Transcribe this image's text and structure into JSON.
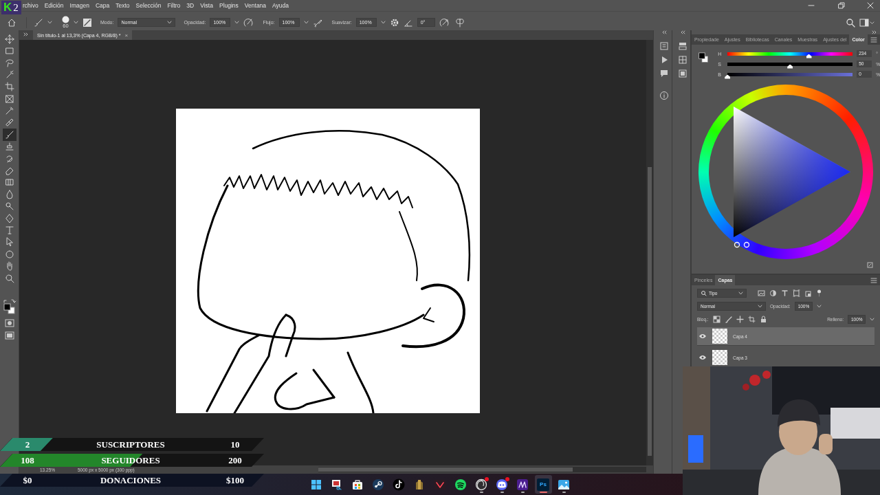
{
  "logo": {
    "mark": "K",
    "number": "2"
  },
  "menu": [
    "rchivo",
    "Edición",
    "Imagen",
    "Capa",
    "Texto",
    "Selección",
    "Filtro",
    "3D",
    "Vista",
    "Plugins",
    "Ventana",
    "Ayuda"
  ],
  "options": {
    "brush_size": "60",
    "mode_label": "Modo:",
    "mode": "Normal",
    "opacity_label": "Opacidad:",
    "opacity": "100%",
    "flow_label": "Flujo:",
    "flow": "100%",
    "smoothing_label": "Suavizar:",
    "smoothing": "100%",
    "angle": "0°"
  },
  "document_tab": {
    "title": "Sin título-1 al 13,3% (Capa 4, RGB/8) *",
    "close": "×"
  },
  "tools": [
    {
      "kind": "move",
      "selected": false
    },
    {
      "kind": "marquee",
      "selected": false
    },
    {
      "kind": "lasso",
      "selected": false
    },
    {
      "kind": "quick",
      "selected": false
    },
    {
      "kind": "crop",
      "selected": false
    },
    {
      "kind": "frame",
      "selected": false
    },
    {
      "kind": "eyedropper",
      "selected": false
    },
    {
      "kind": "healing",
      "selected": false
    },
    {
      "kind": "brush",
      "selected": true
    },
    {
      "kind": "stamp",
      "selected": false
    },
    {
      "kind": "history",
      "selected": false
    },
    {
      "kind": "eraser",
      "selected": false
    },
    {
      "kind": "gradient",
      "selected": false
    },
    {
      "kind": "blur",
      "selected": false
    },
    {
      "kind": "dodge",
      "selected": false
    },
    {
      "kind": "pen",
      "selected": false
    },
    {
      "kind": "text",
      "selected": false
    },
    {
      "kind": "pointer",
      "selected": false
    },
    {
      "kind": "shape",
      "selected": false
    },
    {
      "kind": "hand",
      "selected": false
    },
    {
      "kind": "zoom",
      "selected": false
    }
  ],
  "status_bar": {
    "zoom": "13.25%",
    "size": "5000 px x 5000 px (300 ppp)"
  },
  "color_panel": {
    "tabs": [
      {
        "label": "Propiedade",
        "selected": false
      },
      {
        "label": "Ajustes",
        "selected": false
      },
      {
        "label": "Bibliotecas",
        "selected": false
      },
      {
        "label": "Canales",
        "selected": false
      },
      {
        "label": "Muestras",
        "selected": false
      },
      {
        "label": "Ajustes del",
        "selected": false
      },
      {
        "label": "Color",
        "selected": true
      }
    ],
    "sliders": [
      {
        "kind": "hue",
        "label": "H",
        "value": "234",
        "unit": "°",
        "level": 0.65
      },
      {
        "kind": "saturation",
        "label": "S",
        "value": "50",
        "unit": "%",
        "level": 0.5
      },
      {
        "kind": "brightness",
        "label": "B",
        "value": "0",
        "unit": "%",
        "level": 0
      }
    ]
  },
  "layers_panel": {
    "tabs": [
      {
        "label": "Pinceles",
        "selected": false
      },
      {
        "label": "Capas",
        "selected": true
      }
    ],
    "filter": "Tipo",
    "blend_mode": "Normal",
    "opacity_label": "Opacidad:",
    "opacity": "100%",
    "lock_label": "Bloq.:",
    "fill_label": "Relleno:",
    "fill": "100%",
    "layers": [
      {
        "name": "Capa 4",
        "selected": true,
        "visible": true
      },
      {
        "name": "Capa 3",
        "selected": false,
        "visible": true
      }
    ]
  },
  "stream_stats": [
    {
      "current": "2",
      "label": "SUSCRIPTORES",
      "goal": "10",
      "level": 0.2,
      "color": "#2a8a6c"
    },
    {
      "current": "108",
      "label": "SEGUIDORES",
      "goal": "200",
      "level": 0.54,
      "color": "#23862a"
    },
    {
      "current": "$0",
      "label": "DONACIONES",
      "goal": "$100",
      "level": 0
    }
  ],
  "taskbar": [
    {
      "kind": "windows",
      "running": false,
      "active": false,
      "notification": false
    },
    {
      "kind": "snip",
      "running": false,
      "active": false,
      "notification": false
    },
    {
      "kind": "store",
      "running": false,
      "active": false,
      "notification": false
    },
    {
      "kind": "steam",
      "running": false,
      "active": false,
      "notification": false
    },
    {
      "kind": "note",
      "running": false,
      "active": false,
      "notification": false
    },
    {
      "kind": "tower",
      "running": false,
      "active": false,
      "notification": false
    },
    {
      "kind": "vee",
      "running": false,
      "active": false,
      "notification": false
    },
    {
      "kind": "waves",
      "running": false,
      "active": false,
      "notification": false
    },
    {
      "kind": "aperture",
      "running": true,
      "active": false,
      "notification": true
    },
    {
      "kind": "chat",
      "running": true,
      "active": false,
      "notification": true
    },
    {
      "kind": "scribble",
      "running": true,
      "active": false,
      "notification": false
    },
    {
      "kind": "tile",
      "label": "Ps",
      "running": true,
      "active": true,
      "notification": false
    },
    {
      "kind": "photos",
      "running": true,
      "active": false,
      "notification": false
    }
  ]
}
